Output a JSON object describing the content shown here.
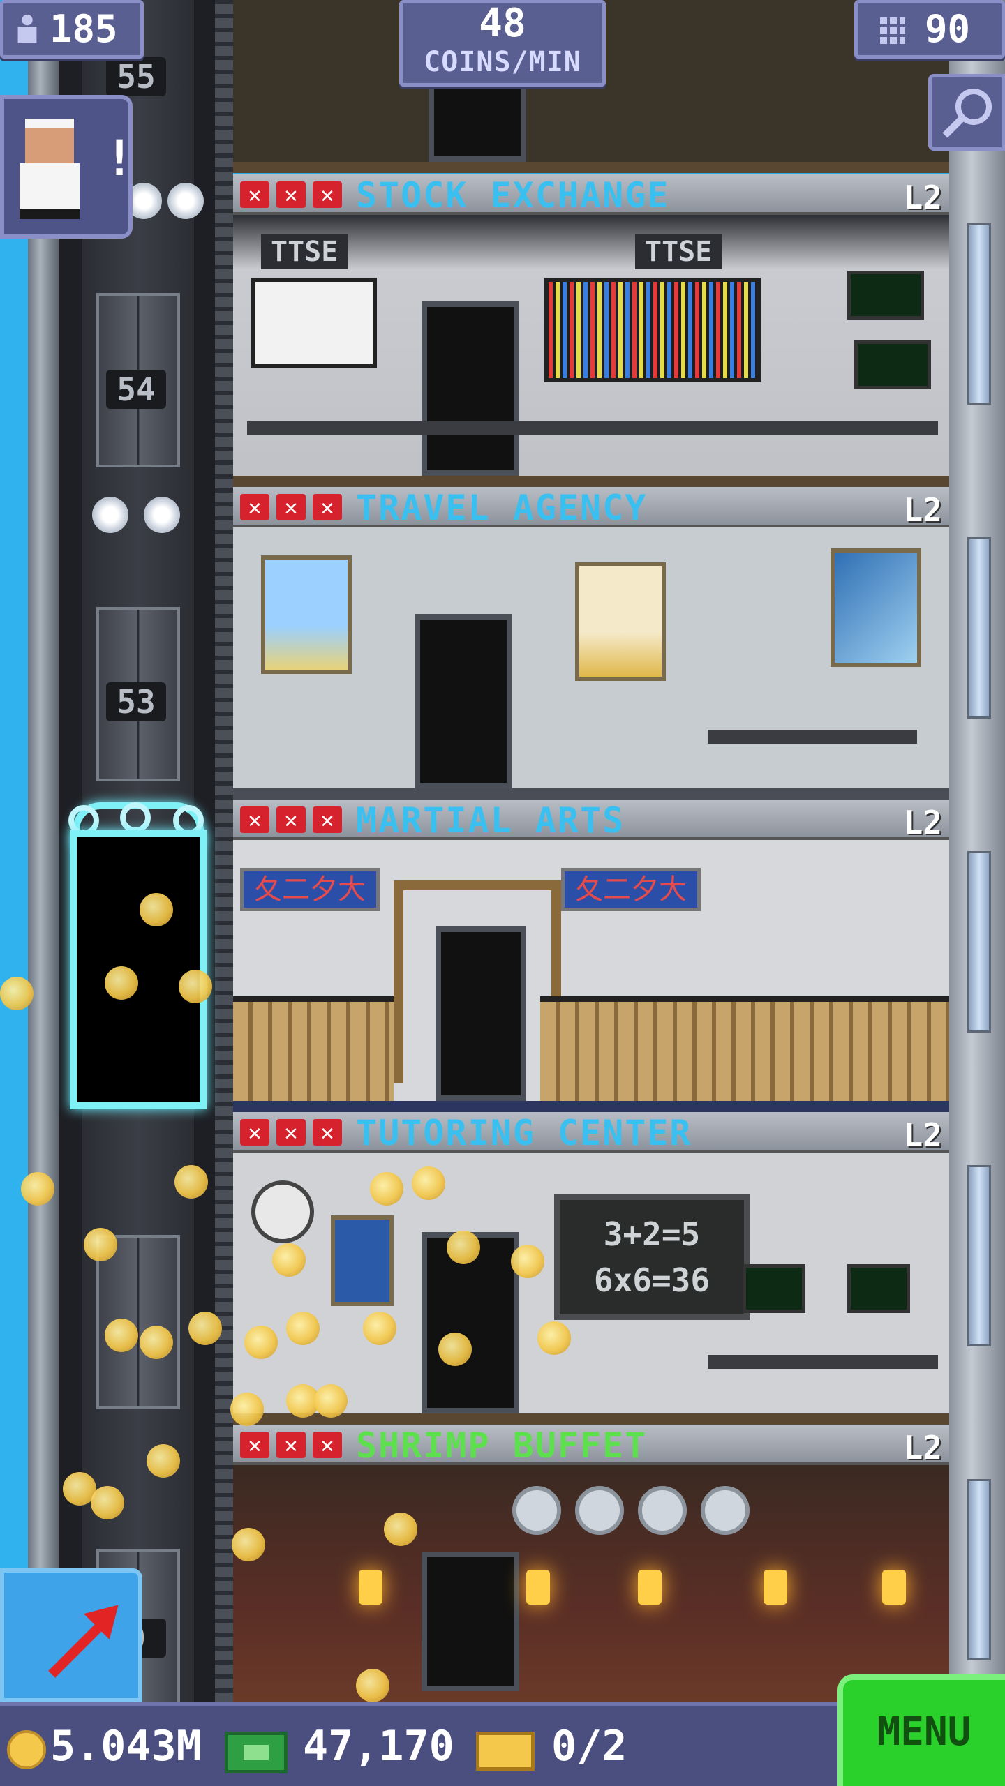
{
  "hud": {
    "population": "185",
    "coins_per_min_value": "48",
    "coins_per_min_label": "COINS/MIN",
    "floor_count": "90"
  },
  "elevator": {
    "floor_numbers": [
      "55",
      "54",
      "53",
      "0"
    ]
  },
  "floors": [
    {
      "name": "STOCK EXCHANGE",
      "level": "L2",
      "color": "#3ac0f0",
      "signs": [
        "TTSE",
        "TTSE"
      ]
    },
    {
      "name": "TRAVEL AGENCY",
      "level": "L2",
      "color": "#3ac0f0"
    },
    {
      "name": "MARTIAL ARTS",
      "level": "L2",
      "color": "#3ac0f0",
      "signs": [
        "⼡⼆⼣⼤",
        "⼡⼆⼣⼤"
      ]
    },
    {
      "name": "TUTORING CENTER",
      "level": "L2",
      "color": "#3ac0f0",
      "blackboard": [
        "3+2=5",
        "6x6=36"
      ]
    },
    {
      "name": "SHRIMP BUFFET",
      "level": "L2",
      "color": "#5ee04e"
    }
  ],
  "bottom_bar": {
    "coins": "5.043M",
    "bux": "47,170",
    "tickets": "0/2",
    "menu_label": "MENU"
  },
  "icons": {
    "population": "person-icon",
    "floors": "building-icon",
    "search": "magnifier-icon",
    "bitizen": "bitizen-alert-icon",
    "elevator": "elevator-arrow-icon",
    "coins": "coin-icon",
    "bux": "bux-icon",
    "tickets": "golden-ticket-icon"
  },
  "colors": {
    "hud_bg": "#5a5f92",
    "menu_green": "#2bd12b",
    "neon_elevator": "#7ff0f6",
    "coin_gold": "#f4c84a"
  }
}
